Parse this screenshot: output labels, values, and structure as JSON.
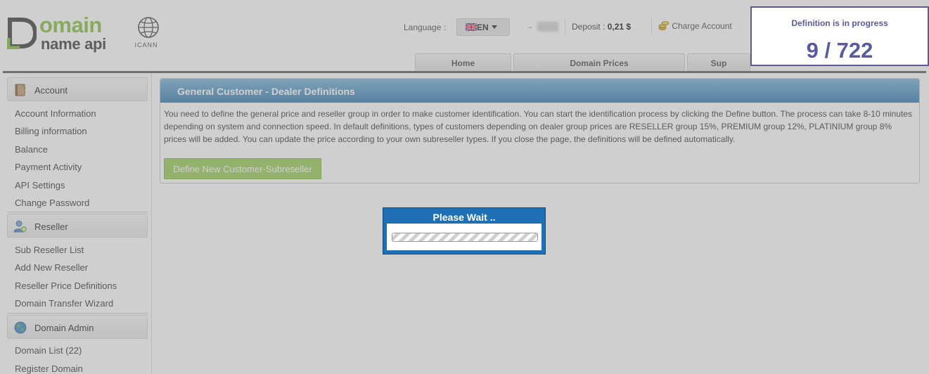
{
  "header": {
    "logo_line1": "omain",
    "logo_line2": "name api",
    "icann_label": "ICANN",
    "language_label": "Language :",
    "language_code": "EN",
    "deposit_label": "Deposit :",
    "deposit_value": "0,21 $",
    "charge_label": "Charge Account"
  },
  "tabs": [
    {
      "label": "Home"
    },
    {
      "label": "Domain Prices"
    },
    {
      "label": "Sup"
    }
  ],
  "progress": {
    "title": "Definition is in progress",
    "count": "9 / 722",
    "done": 9,
    "total": 722
  },
  "sidebar": {
    "account": {
      "title": "Account",
      "items": [
        "Account Information",
        "Billing information",
        "Balance",
        "Payment Activity",
        "API Settings",
        "Change Password"
      ]
    },
    "reseller": {
      "title": "Reseller",
      "items": [
        "Sub Reseller List",
        "Add New Reseller",
        "Reseller Price Definitions",
        "Domain Transfer Wizard"
      ]
    },
    "domain_admin": {
      "title": "Domain Admin",
      "items": [
        "Domain List (22)",
        "Register Domain"
      ]
    }
  },
  "main": {
    "panel_title": "General Customer - Dealer Definitions",
    "description": "You need to define the general price and reseller group in order to make customer identification. You can start the identification process by clicking the Define button. The process can take 8-10 minutes depending on system and connection speed. In default definitions, types of customers depending on dealer group prices are RESELLER group 15%, PREMIUM group 12%, PLATINIUM group 8% prices will be added. You can update the price according to your own subreseller types. If you close the page, the definitions will be defined automatically.",
    "define_button": "Define New Customer-Subreseller"
  },
  "wait_dialog": {
    "title": "Please Wait .."
  },
  "colors": {
    "accent_green": "#8bc34a",
    "panel_blue": "#3f83b4",
    "progress_purple": "#5a5a9e",
    "dialog_blue": "#1f6fb4"
  }
}
